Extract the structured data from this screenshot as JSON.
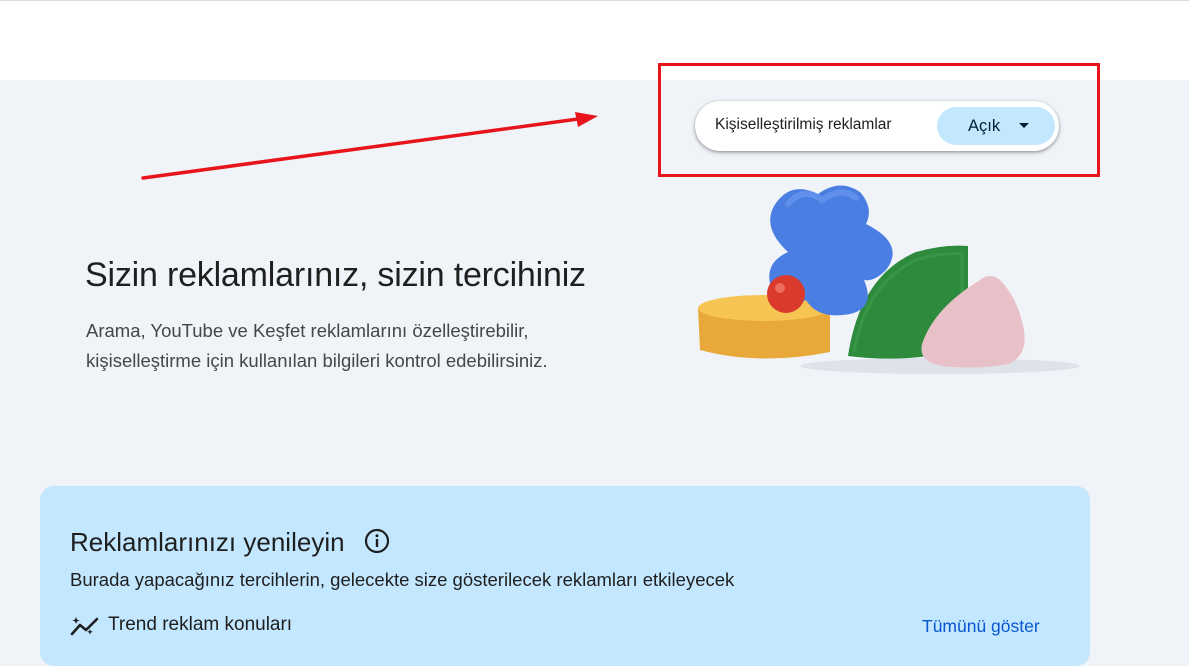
{
  "hero": {
    "title": "Sizin reklamlarınız, sizin tercihiniz",
    "description_line1": "Arama, YouTube ve Keşfet reklamlarını özelleştirebilir,",
    "description_line2": "kişiselleştirme için kullanılan bilgileri kontrol edebilirsiniz."
  },
  "personalized_ads": {
    "label": "Kişiselleştirilmiş reklamlar",
    "selected_value": "Açık"
  },
  "annotation": {
    "color": "#e8141c"
  },
  "refresh_section": {
    "title": "Reklamlarınızı yenileyin",
    "description": "Burada yapacağınız tercihlerin, gelecekte size gösterilecek reklamları etkileyecek",
    "trend_title": "Trend reklam konuları",
    "show_all_label": "Tümünü göster",
    "background_color": "#c2e7ff"
  },
  "icons": {
    "info": "info-icon",
    "trend": "trend-icon",
    "caret": "caret-down-icon"
  },
  "colors": {
    "accent_link": "#0b57d0",
    "toggle_bg": "#c2e7ff"
  }
}
